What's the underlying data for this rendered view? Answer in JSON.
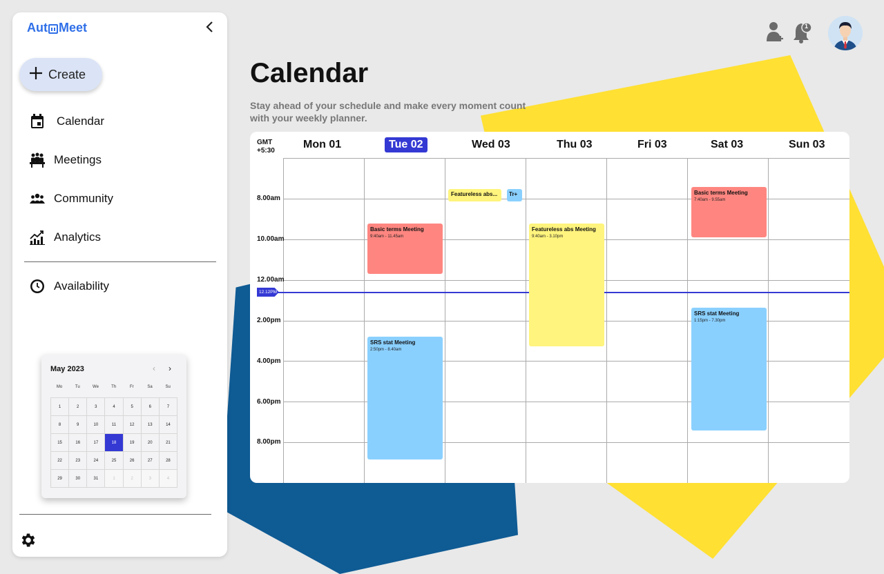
{
  "app": {
    "logo_left": "Aut",
    "logo_right": "Meet"
  },
  "sidebar": {
    "create_label": "Create",
    "items": [
      {
        "label": "Calendar",
        "icon": "calendar-icon"
      },
      {
        "label": "Meetings",
        "icon": "meetings-icon"
      },
      {
        "label": "Community",
        "icon": "community-icon"
      },
      {
        "label": "Analytics",
        "icon": "analytics-icon"
      },
      {
        "label": "Availability",
        "icon": "clock-icon"
      }
    ]
  },
  "mini_calendar": {
    "title": "May 2023",
    "days_of_week": [
      "Mo",
      "Tu",
      "We",
      "Th",
      "Fr",
      "Sa",
      "Su"
    ],
    "dates": [
      "1",
      "2",
      "3",
      "4",
      "5",
      "6",
      "7",
      "8",
      "9",
      "10",
      "11",
      "12",
      "13",
      "14",
      "15",
      "16",
      "17",
      "18",
      "19",
      "20",
      "21",
      "22",
      "23",
      "24",
      "25",
      "26",
      "27",
      "28",
      "29",
      "30",
      "31",
      "1",
      "2",
      "3",
      "4"
    ],
    "selected": "18"
  },
  "header": {
    "notification_count": "1"
  },
  "page": {
    "title": "Calendar",
    "subtitle": "Stay ahead of your schedule and make every moment count with your weekly planner."
  },
  "calendar": {
    "timezone_line1": "GMT",
    "timezone_line2": "+5:30",
    "days": [
      "Mon 01",
      "Tue 02",
      "Wed 03",
      "Thu 03",
      "Fri 03",
      "Sat 03",
      "Sun 03"
    ],
    "active_day": "Tue 02",
    "time_labels": [
      "8.00am",
      "10.00am",
      "12.00am",
      "2.00pm",
      "4.00pm",
      "6.00pm",
      "8.00pm"
    ],
    "now_label": "12.12PM",
    "events": [
      {
        "title": "Basic terms Meeting",
        "time": "9:40am - 11.45am",
        "day": "Tue 02",
        "color": "#ff8680"
      },
      {
        "title": "SRS stat Meeting",
        "time": "2:50pm - 8.40am",
        "day": "Tue 02",
        "color": "#8ad0ff"
      },
      {
        "title": "Featureless abs...",
        "time": "",
        "day": "Wed 03",
        "color": "#fff47d"
      },
      {
        "title": "Tr+",
        "time": "",
        "day": "Wed 03",
        "color": "#8ad0ff"
      },
      {
        "title": "Featureless abs Meeting",
        "time": "9:40am - 3.10pm",
        "day": "Thu 03",
        "color": "#fff47d"
      },
      {
        "title": "Basic terms Meeting",
        "time": "7:40am - 9.55am",
        "day": "Sat 03",
        "color": "#ff8680"
      },
      {
        "title": "SRS stat Meeting",
        "time": "1:15pm - 7.30pm",
        "day": "Sat 03",
        "color": "#8ad0ff"
      }
    ]
  },
  "colors": {
    "accent": "#3439d4",
    "brand": "#2f6fe8",
    "red_event": "#ff8680",
    "yellow_event": "#fff47d",
    "blue_event": "#8ad0ff"
  }
}
